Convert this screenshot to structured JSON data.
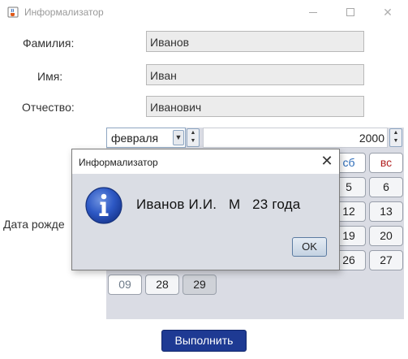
{
  "window": {
    "title": "Информализатор",
    "icon": "java-cup-icon",
    "controls": [
      "minimize",
      "maximize",
      "close"
    ]
  },
  "form": {
    "surname": {
      "label": "Фамилия:",
      "value": "Иванов"
    },
    "name": {
      "label": "Имя:",
      "value": "Иван"
    },
    "patronymic": {
      "label": "Отчество:",
      "value": "Иванович"
    },
    "birthdate_label": "Дата рожде"
  },
  "calendar": {
    "month": "февраля",
    "year": "2000",
    "header_visible": {
      "sat": "сб",
      "sun": "вс"
    },
    "visible_days": {
      "row1": [
        "5",
        "6"
      ],
      "row2": [
        "12",
        "13"
      ],
      "row3": [
        "19",
        "20"
      ],
      "row4": [
        "26",
        "27"
      ],
      "row5": [
        "09",
        "28",
        "29"
      ]
    },
    "selected_day": "29"
  },
  "execute_button": "Выполнить",
  "dialog": {
    "title": "Информализатор",
    "close_glyph": "✕",
    "message": "Иванов И.И.   М   23 года",
    "ok_label": "OK",
    "icon": "information-icon"
  },
  "colors": {
    "execute_bg": "#1e3a93",
    "calendar_bg": "#dadce4",
    "dialog_bg": "#dadde4",
    "sat_color": "#2b6bb8",
    "sun_color": "#b22222"
  }
}
